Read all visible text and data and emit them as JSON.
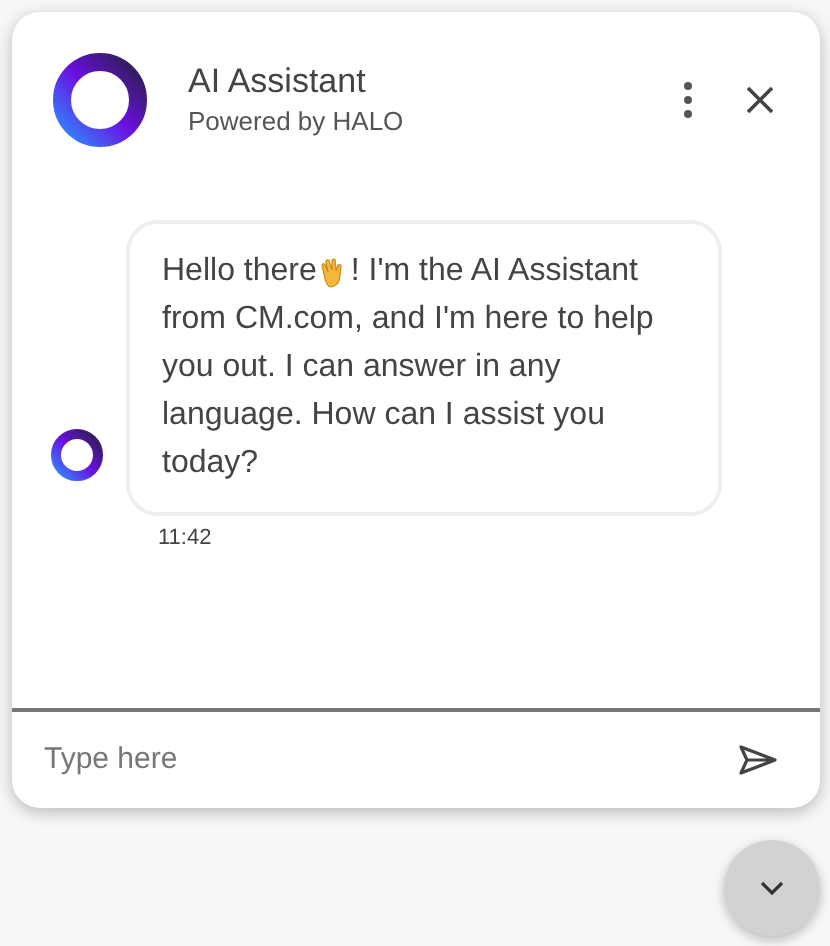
{
  "header": {
    "title": "AI Assistant",
    "subtitle": "Powered by HALO"
  },
  "messages": [
    {
      "kind": "bot",
      "text_before": "Hello there",
      "text_after": "! I'm the AI Assistant",
      "text_rest": "from CM.com, and I'm here to help you out. I can answer in any language. How can I assist you today?",
      "time": "11:42"
    }
  ],
  "composer": {
    "placeholder": "Type here"
  }
}
